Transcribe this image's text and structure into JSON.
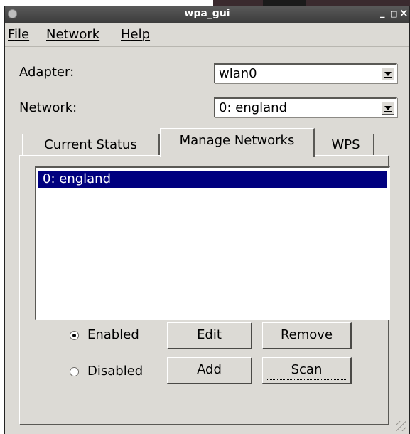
{
  "window": {
    "title": "wpa_gui"
  },
  "titlebar": {
    "minimize": "_",
    "maximize": "□",
    "close": "×"
  },
  "menu": [
    {
      "hotkey": "F",
      "rest": "ile"
    },
    {
      "hotkey": "N",
      "rest": "etwork"
    },
    {
      "hotkey": "H",
      "rest": "elp"
    }
  ],
  "adapter": {
    "label": "Adapter:",
    "value": "wlan0"
  },
  "network": {
    "label": "Network:",
    "value": "0: england"
  },
  "tabs": [
    {
      "label": "Current Status",
      "active": false
    },
    {
      "label": "Manage Networks",
      "active": true
    },
    {
      "label": "WPS",
      "active": false
    }
  ],
  "networks_list": [
    {
      "label": "0: england",
      "selected": true
    }
  ],
  "radios": {
    "enabled": {
      "label": "Enabled",
      "checked": true
    },
    "disabled": {
      "label": "Disabled",
      "checked": false
    }
  },
  "buttons": {
    "edit": "Edit",
    "remove": "Remove",
    "add": "Add",
    "scan": "Scan"
  },
  "colors": {
    "selection": "#00007f",
    "window_bg": "#dcdad5",
    "titlebar": "#3c3c3c"
  }
}
